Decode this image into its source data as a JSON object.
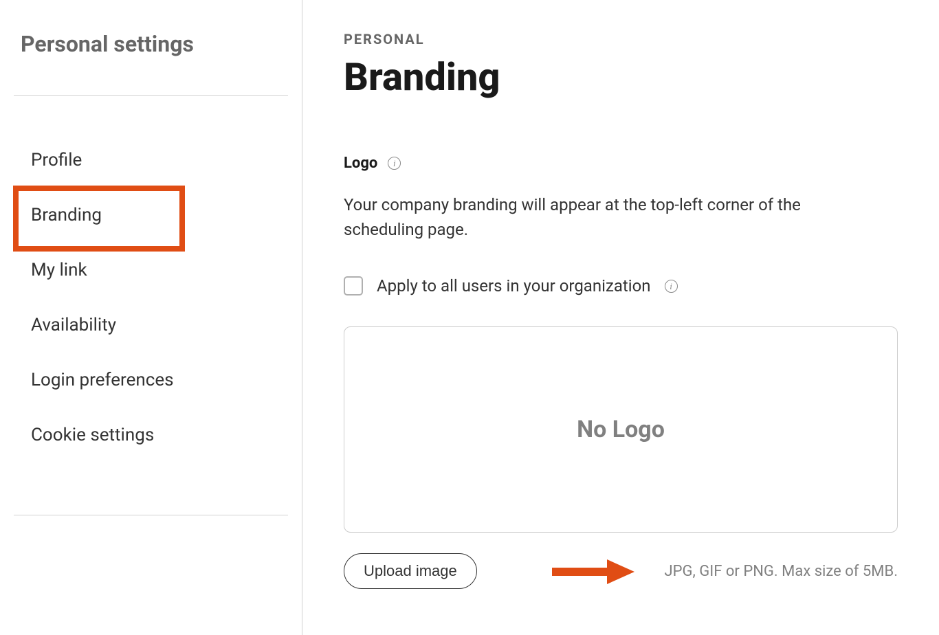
{
  "sidebar": {
    "title": "Personal settings",
    "items": [
      {
        "label": "Profile",
        "active": false
      },
      {
        "label": "Branding",
        "active": true
      },
      {
        "label": "My link",
        "active": false
      },
      {
        "label": "Availability",
        "active": false
      },
      {
        "label": "Login preferences",
        "active": false
      },
      {
        "label": "Cookie settings",
        "active": false
      }
    ]
  },
  "main": {
    "eyebrow": "PERSONAL",
    "title": "Branding",
    "logo": {
      "label": "Logo",
      "description": "Your company branding will appear at the top-left corner of the scheduling page.",
      "apply_all_label": "Apply to all users in your organization",
      "preview_placeholder": "No Logo",
      "upload_button": "Upload image",
      "upload_hint": "JPG, GIF or PNG. Max size of 5MB."
    }
  },
  "annotations": {
    "highlight_color": "#e04d14"
  }
}
